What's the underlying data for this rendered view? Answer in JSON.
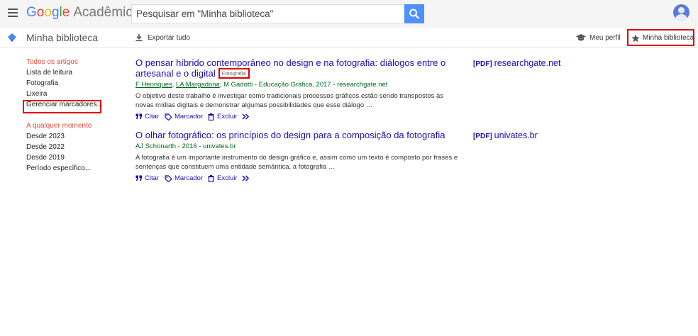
{
  "header": {
    "logo_letters": [
      "G",
      "o",
      "o",
      "g",
      "l",
      "e"
    ],
    "logo_product": "Acadêmico",
    "search_placeholder": "Pesquisar em \"Minha biblioteca\"",
    "icons": {
      "menu": "hamburger-menu-icon",
      "search": "magnifier-icon",
      "avatar": "user-avatar-icon"
    }
  },
  "subbar": {
    "title": "Minha biblioteca",
    "export_label": "Exportar tudo",
    "profile_label": "Meu perfil",
    "library_label": "Minha biblioteca"
  },
  "sidebar": {
    "labels": [
      {
        "label": "Todos os artigos",
        "active": true
      },
      {
        "label": "Lista de leitura"
      },
      {
        "label": "Fotografia"
      },
      {
        "label": "Lixeira"
      },
      {
        "label": "Gerenciar marcadores..."
      }
    ],
    "time_heading": "A qualquer momento",
    "time_filters": [
      "Desde 2023",
      "Desde 2022",
      "Desde 2019",
      "Período específico..."
    ]
  },
  "results": [
    {
      "title": "O pensar híbrido contemporâneo no design e na fotografia: diálogos entre o artesanal e o digital",
      "tag": "Fotografia",
      "authors": [
        "F Henriques",
        "LA Margadona",
        "M Gadotti"
      ],
      "source": " - Educação Gráfica, 2017 - researchgate.net",
      "snippet": "O objetivo deste trabalho é investigar como tradicionais processos gráficos estão sendo transpostos às novas mídias digitais e demonstrar algumas possibilidades que esse diálogo …",
      "actions": {
        "cite": "Citar",
        "label": "Marcador",
        "delete": "Excluir"
      },
      "pdf_tag": "[PDF]",
      "pdf_source": "researchgate.net"
    },
    {
      "title": "O olhar fotográfico: os princípios do design para a composição da fotografia",
      "authors_line": "AJ Schonarth - 2016 - univates.br",
      "snippet": "A fotografia é um importante instrumento do design gráfico e, assim como um texto é composto por frases e sentenças que constituem uma entidade semântica, a fotografia …",
      "actions": {
        "cite": "Citar",
        "label": "Marcador",
        "delete": "Excluir"
      },
      "pdf_tag": "[PDF]",
      "pdf_source": "univates.br"
    }
  ],
  "colors": {
    "link": "#1a0dab",
    "meta_green": "#006621",
    "accent_red": "#dd4b39",
    "highlight_box": "#e0000a",
    "search_blue": "#4d90fe"
  }
}
